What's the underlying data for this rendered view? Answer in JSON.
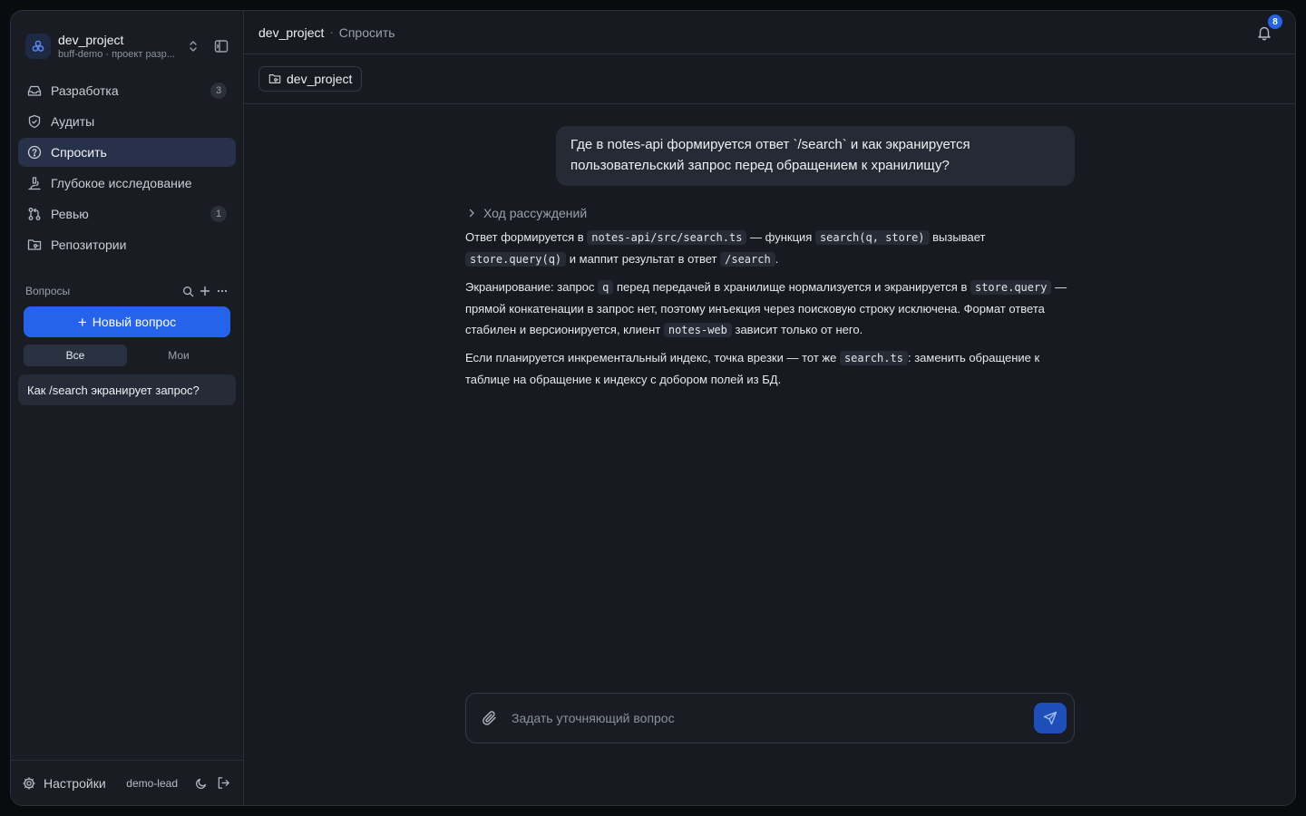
{
  "workspace": {
    "name": "dev_project",
    "subtitle": "buff-demo · проект разр..."
  },
  "nav": {
    "items": [
      {
        "label": "Разработка",
        "badge": "3",
        "icon": "inbox-icon"
      },
      {
        "label": "Аудиты",
        "badge": "",
        "icon": "shield-check-icon"
      },
      {
        "label": "Спросить",
        "badge": "",
        "icon": "help-circle-icon",
        "active": true
      },
      {
        "label": "Глубокое исследование",
        "badge": "",
        "icon": "microscope-icon"
      },
      {
        "label": "Ревью",
        "badge": "1",
        "icon": "git-pull-request-icon"
      },
      {
        "label": "Репозитории",
        "badge": "",
        "icon": "folder-git-icon"
      }
    ]
  },
  "questions": {
    "title": "Вопросы",
    "new_button": "Новый вопрос",
    "filters": [
      "Все",
      "Мои"
    ],
    "items": [
      "Как /search экранирует запрос?"
    ]
  },
  "footer": {
    "settings": "Настройки",
    "user": "demo-lead"
  },
  "topbar": {
    "project": "dev_project",
    "separator": "·",
    "page": "Спросить",
    "notifications": "8"
  },
  "context": {
    "repo": "dev_project"
  },
  "thread": {
    "question": "Где в notes-api формируется ответ `/search` и как экранируется пользовательский запрос перед обращением к хранилищу?",
    "reasoning_label": "Ход рассуждений",
    "answer": {
      "p1": {
        "t1": "Ответ формируется в ",
        "c1": "notes-api/src/search.ts",
        "t2": " — функция ",
        "c2": "search(q, store)",
        "t3": " вызывает ",
        "c3": "store.query(q)",
        "t4": " и маппит результат в ответ ",
        "c4": "/search",
        "t5": "."
      },
      "p2": {
        "t1": "Экранирование: запрос ",
        "c1": "q",
        "t2": " перед передачей в хранилище нормализуется и экранируется в ",
        "c2": "store.query",
        "t3": " — прямой конкатенации в запрос нет, поэтому инъекция через поисковую строку исключена. Формат ответа стабилен и версионируется, клиент ",
        "c3": "notes-web",
        "t4": " зависит только от него."
      },
      "p3": {
        "t1": "Если планируется инкрементальный индекс, точка врезки — тот же ",
        "c1": "search.ts",
        "t2": ": заменить обращение к таблице на обращение к индексу с добором полей из БД."
      }
    }
  },
  "composer": {
    "placeholder": "Задать уточняющий вопрос"
  },
  "colors": {
    "accent": "#2563eb",
    "background": "#171a21",
    "sidebar": "#191c23"
  }
}
